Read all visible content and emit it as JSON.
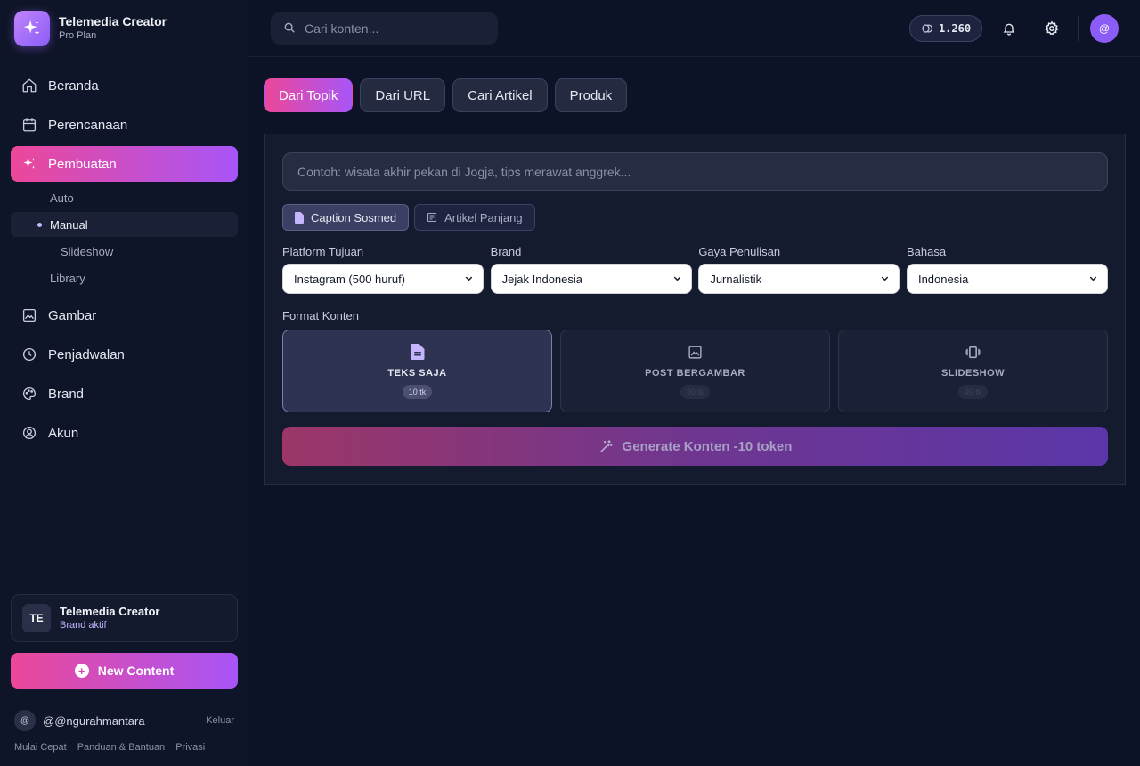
{
  "app": {
    "name": "Telemedia Creator",
    "plan": "Pro Plan"
  },
  "sidebar": {
    "items": [
      {
        "label": "Beranda",
        "icon": "home-icon"
      },
      {
        "label": "Perencanaan",
        "icon": "calendar-icon"
      },
      {
        "label": "Pembuatan",
        "icon": "sparkles-icon",
        "active": true
      },
      {
        "label": "Gambar",
        "icon": "image-icon"
      },
      {
        "label": "Penjadwalan",
        "icon": "clock-icon"
      },
      {
        "label": "Brand",
        "icon": "palette-icon"
      },
      {
        "label": "Akun",
        "icon": "user-circle-icon"
      }
    ],
    "subitems": {
      "auto": "Auto",
      "manual": "Manual",
      "slideshow": "Slideshow",
      "library": "Library"
    },
    "brand_card": {
      "badge": "TE",
      "name": "Telemedia Creator",
      "status": "Brand aktif"
    },
    "new_content": "New Content",
    "user": {
      "avatar": "@",
      "handle": "@@ngurahmantara",
      "logout": "Keluar"
    },
    "footer": [
      "Mulai Cepat",
      "Panduan & Bantuan",
      "Privasi"
    ]
  },
  "topbar": {
    "search_placeholder": "Cari konten...",
    "tokens": "1.260",
    "avatar": "@"
  },
  "tabs": [
    "Dari Topik",
    "Dari URL",
    "Cari Artikel",
    "Produk"
  ],
  "form": {
    "topic_placeholder": "Contoh: wisata akhir pekan di Jogja, tips merawat anggrek...",
    "types": [
      "Caption Sosmed",
      "Artikel Panjang"
    ],
    "fields": [
      {
        "label": "Platform Tujuan",
        "value": "Instagram (500 huruf)"
      },
      {
        "label": "Brand",
        "value": "Jejak Indonesia"
      },
      {
        "label": "Gaya Penulisan",
        "value": "Jurnalistik"
      },
      {
        "label": "Bahasa",
        "value": "Indonesia"
      }
    ],
    "format_label": "Format Konten",
    "formats": [
      {
        "name": "TEKS SAJA",
        "cost": "10 tk",
        "icon": "document-icon"
      },
      {
        "name": "POST BERGAMBAR",
        "cost": "30 tk",
        "icon": "image-icon"
      },
      {
        "name": "SLIDESHOW",
        "cost": "90 tk",
        "icon": "slides-icon"
      }
    ],
    "generate_label": "Generate Konten -10 token"
  },
  "colors": {
    "background": "#0d1326",
    "accent_start": "#ec4899",
    "accent_end": "#a855f7",
    "card": "#151b2f"
  }
}
